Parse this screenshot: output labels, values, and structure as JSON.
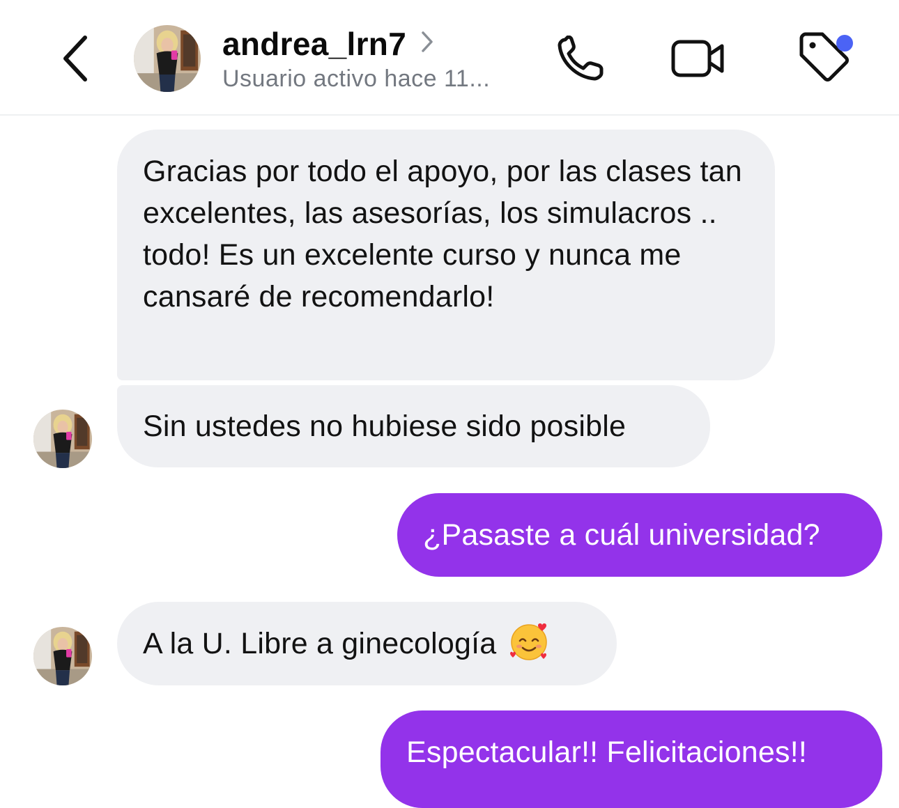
{
  "header": {
    "username": "andrea_lrn7",
    "status": "Usuario activo hace 11...",
    "back_icon": "chevron-left-icon",
    "call_icon": "phone-icon",
    "video_icon": "video-camera-icon",
    "tag_icon": "tag-icon",
    "notification_dot_color": "#4b63f5"
  },
  "messages": [
    {
      "sender": "other",
      "text": "Gracias por todo el apoyo, por las clases tan excelentes, las asesorías, los simulacros .. todo! Es un excelente curso y nunca me cansaré de recomendarlo!"
    },
    {
      "sender": "other",
      "text": "Sin ustedes no hubiese sido posible"
    },
    {
      "sender": "me",
      "text": "¿Pasaste a cuál universidad?"
    },
    {
      "sender": "other",
      "text": "A la U. Libre a ginecología",
      "emoji": "smiling-face-with-hearts-emoji"
    },
    {
      "sender": "me",
      "text": "Espectacular!! Felicitaciones!!"
    }
  ],
  "colors": {
    "incoming_bubble": "#eff0f3",
    "outgoing_bubble": "#9333ea",
    "outgoing_text": "#ffffff"
  }
}
